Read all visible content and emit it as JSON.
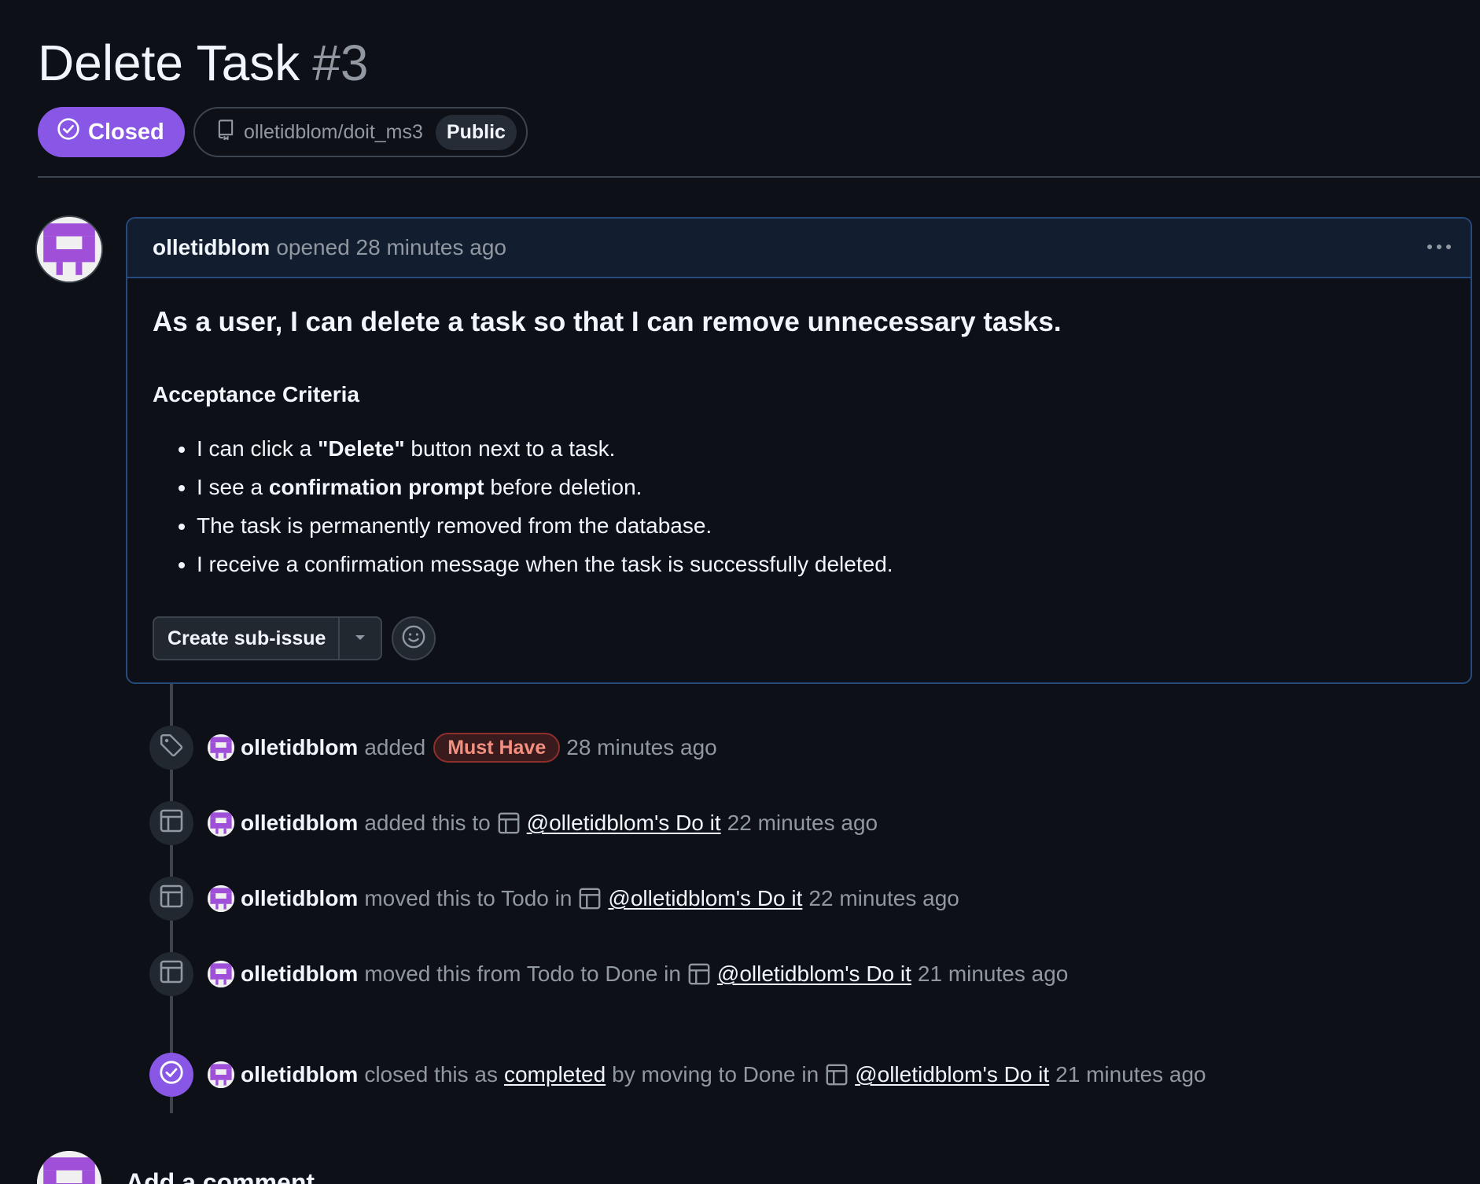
{
  "issue": {
    "title": "Delete Task",
    "number": "#3",
    "state": "Closed",
    "repo": "olletidblom/doit_ms3",
    "visibility": "Public"
  },
  "comment": {
    "author": "olletidblom",
    "meta": "opened 28 minutes ago",
    "heading": "As a user, I can delete a task so that I can remove unnecessary tasks.",
    "subheading": "Acceptance Criteria",
    "criteria": [
      {
        "pre": "I can click a ",
        "bold": "\"Delete\"",
        "post": " button next to a task."
      },
      {
        "pre": "I see a ",
        "bold": "confirmation prompt",
        "post": " before deletion."
      },
      {
        "pre": "The task is permanently removed from the database.",
        "bold": "",
        "post": ""
      },
      {
        "pre": "I receive a confirmation message when the task is successfully deleted.",
        "bold": "",
        "post": ""
      }
    ],
    "create_subissue_label": "Create sub-issue"
  },
  "timeline": {
    "events": [
      {
        "author": "olletidblom",
        "action": "added",
        "label": "Must Have",
        "time": "28 minutes ago"
      },
      {
        "author": "olletidblom",
        "action": "added this to",
        "project": "@olletidblom's Do it",
        "time": "22 minutes ago"
      },
      {
        "author": "olletidblom",
        "action": "moved this to Todo in",
        "project": "@olletidblom's Do it",
        "time": "22 minutes ago"
      },
      {
        "author": "olletidblom",
        "action": "moved this from Todo to Done in",
        "project": "@olletidblom's Do it",
        "time": "21 minutes ago"
      },
      {
        "author": "olletidblom",
        "action": "closed this as",
        "link": "completed",
        "action2": "by moving to Done in",
        "project": "@olletidblom's Do it",
        "time": "21 minutes ago"
      }
    ]
  },
  "add_comment": {
    "heading": "Add a comment"
  },
  "colors": {
    "background": "#0d1117",
    "closed_purple": "#8957e5",
    "border": "#3d444d",
    "muted_text": "#9198a1",
    "label_must_have": "#f4907f"
  },
  "icons": {
    "state": "check-circle-icon",
    "repo": "repo-icon",
    "more": "kebab-horizontal-icon",
    "caret": "triangle-down-icon",
    "emoji": "smiley-icon",
    "label_event": "tag-icon",
    "project_event": "table-icon",
    "closed_event": "check-circle-icon"
  }
}
